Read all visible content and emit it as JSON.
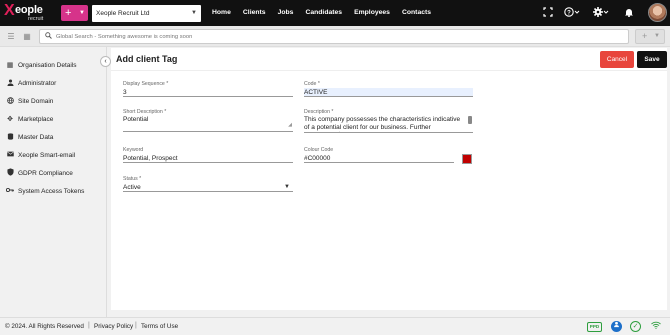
{
  "app": {
    "logo_text": "eople",
    "logo_x": "X",
    "logo_sub": "recruit"
  },
  "topbar": {
    "add_label": "+",
    "company": "Xeople Recruit Ltd",
    "nav": [
      "Home",
      "Clients",
      "Jobs",
      "Candidates",
      "Employees",
      "Contacts"
    ],
    "icons": [
      "fullscreen-icon",
      "help-icon",
      "gear-icon",
      "bell-icon"
    ]
  },
  "subbar": {
    "search_placeholder": "Global Search - Something awesome is coming soon",
    "plus_label": "+"
  },
  "sidebar": {
    "items": [
      {
        "label": "Organisation Details",
        "icon": "building-icon"
      },
      {
        "label": "Administrator",
        "icon": "person-icon"
      },
      {
        "label": "Site Domain",
        "icon": "globe-icon"
      },
      {
        "label": "Marketplace",
        "icon": "arrows-icon"
      },
      {
        "label": "Master Data",
        "icon": "database-icon"
      },
      {
        "label": "Xeople Smart-email",
        "icon": "envelope-icon"
      },
      {
        "label": "GDPR Compliance",
        "icon": "shield-icon"
      },
      {
        "label": "System Access Tokens",
        "icon": "key-icon"
      }
    ]
  },
  "page": {
    "title": "Add client Tag",
    "cancel_label": "Cancel",
    "save_label": "Save"
  },
  "form": {
    "display_sequence": {
      "label": "Display Sequence *",
      "value": "3"
    },
    "code": {
      "label": "Code *",
      "value": "ACTIVE"
    },
    "short_description": {
      "label": "Short Description *",
      "value": "Potential"
    },
    "description": {
      "label": "Description *",
      "value": "This company possesses the characteristics indicative of a potential client for our business. Further engagement"
    },
    "keyword": {
      "label": "Keyword",
      "value": "Potential, Prospect"
    },
    "colour_code": {
      "label": "Colour Code",
      "value": "#C00000",
      "swatch": "#c00000"
    },
    "status": {
      "label": "Status *",
      "value": "Active"
    }
  },
  "footer": {
    "copyright": "© 2024. All Rights Reserved",
    "privacy": "Privacy Policy",
    "terms": "Terms of Use",
    "ppd": "PPD"
  },
  "colors": {
    "brand": "#e0205a",
    "add_button": "#d6338a",
    "cancel": "#e8453c",
    "save": "#111111"
  }
}
